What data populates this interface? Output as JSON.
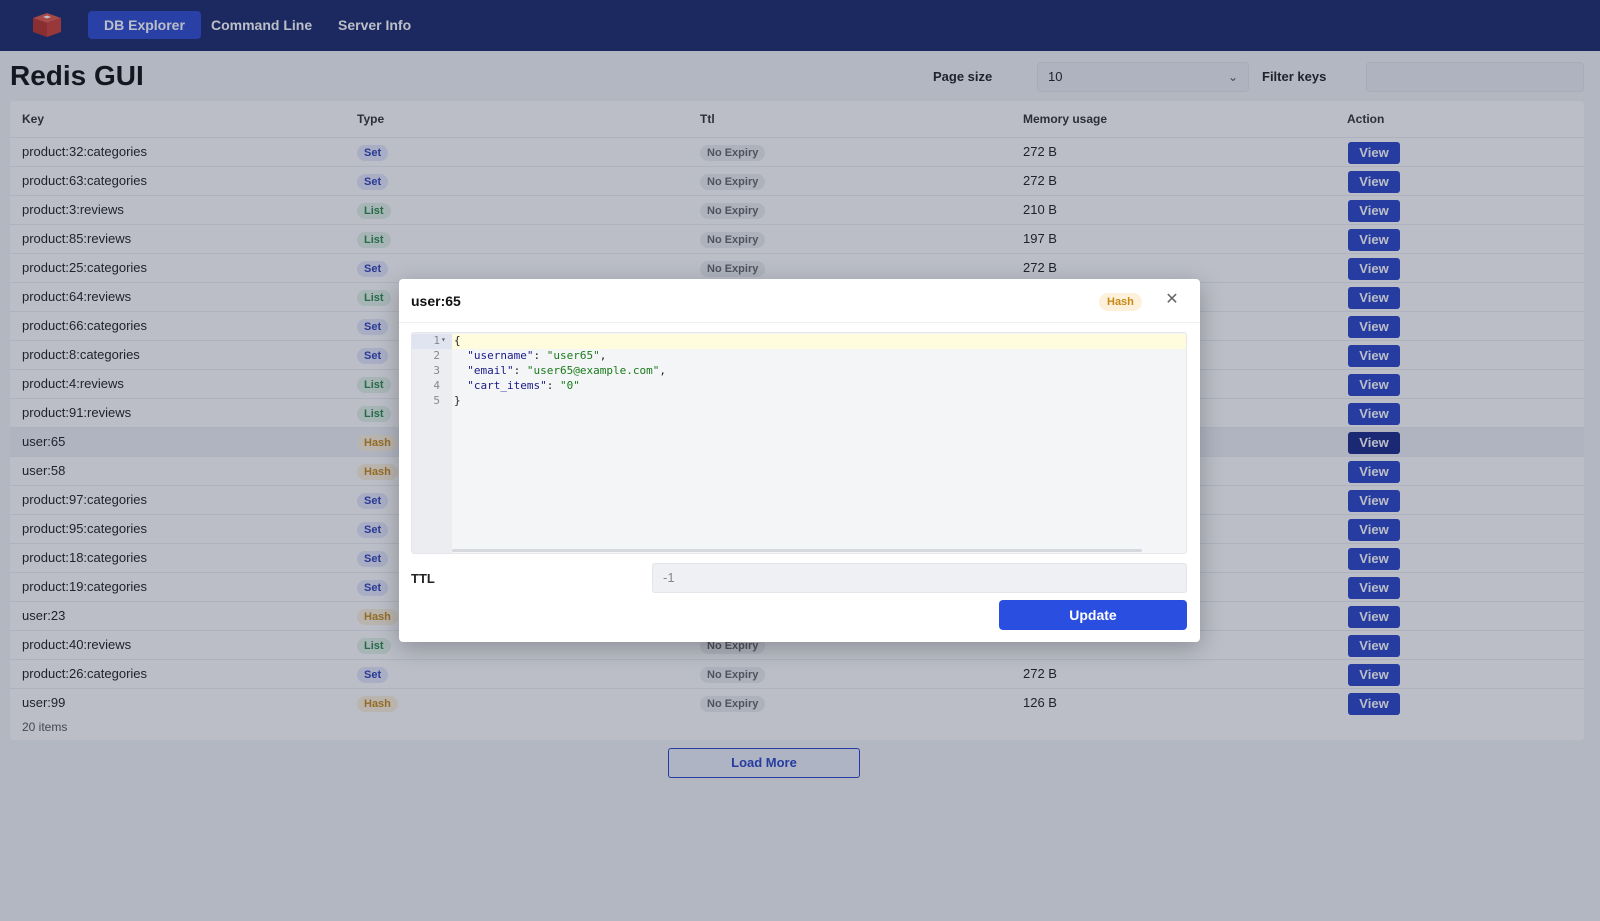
{
  "nav": {
    "logo_icon": "redis-logo-icon",
    "items": [
      {
        "label": "DB Explorer",
        "active": true
      },
      {
        "label": "Command Line",
        "active": false
      },
      {
        "label": "Server Info",
        "active": false
      }
    ]
  },
  "page": {
    "title": "Redis GUI",
    "page_size_label": "Page size",
    "page_size_value": "10",
    "filter_label": "Filter keys",
    "filter_placeholder": ""
  },
  "table": {
    "headers": [
      "Key",
      "Type",
      "Ttl",
      "Memory usage",
      "Action"
    ],
    "rows": [
      {
        "key": "product:32:categories",
        "type": "Set",
        "ttl": "No Expiry",
        "memory": "272 B",
        "action": "View"
      },
      {
        "key": "product:63:categories",
        "type": "Set",
        "ttl": "No Expiry",
        "memory": "272 B",
        "action": "View"
      },
      {
        "key": "product:3:reviews",
        "type": "List",
        "ttl": "No Expiry",
        "memory": "210 B",
        "action": "View"
      },
      {
        "key": "product:85:reviews",
        "type": "List",
        "ttl": "No Expiry",
        "memory": "197 B",
        "action": "View"
      },
      {
        "key": "product:25:categories",
        "type": "Set",
        "ttl": "No Expiry",
        "memory": "272 B",
        "action": "View"
      },
      {
        "key": "product:64:reviews",
        "type": "List",
        "ttl": "",
        "memory": "",
        "action": "View"
      },
      {
        "key": "product:66:categories",
        "type": "Set",
        "ttl": "",
        "memory": "",
        "action": "View"
      },
      {
        "key": "product:8:categories",
        "type": "Set",
        "ttl": "",
        "memory": "",
        "action": "View"
      },
      {
        "key": "product:4:reviews",
        "type": "List",
        "ttl": "",
        "memory": "",
        "action": "View"
      },
      {
        "key": "product:91:reviews",
        "type": "List",
        "ttl": "",
        "memory": "",
        "action": "View"
      },
      {
        "key": "user:65",
        "type": "Hash",
        "ttl": "",
        "memory": "",
        "action": "View"
      },
      {
        "key": "user:58",
        "type": "Hash",
        "ttl": "",
        "memory": "",
        "action": "View"
      },
      {
        "key": "product:97:categories",
        "type": "Set",
        "ttl": "",
        "memory": "",
        "action": "View"
      },
      {
        "key": "product:95:categories",
        "type": "Set",
        "ttl": "",
        "memory": "",
        "action": "View"
      },
      {
        "key": "product:18:categories",
        "type": "Set",
        "ttl": "",
        "memory": "",
        "action": "View"
      },
      {
        "key": "product:19:categories",
        "type": "Set",
        "ttl": "",
        "memory": "",
        "action": "View"
      },
      {
        "key": "user:23",
        "type": "Hash",
        "ttl": "",
        "memory": "",
        "action": "View"
      },
      {
        "key": "product:40:reviews",
        "type": "List",
        "ttl": "No Expiry",
        "memory": "",
        "action": "View"
      },
      {
        "key": "product:26:categories",
        "type": "Set",
        "ttl": "No Expiry",
        "memory": "272 B",
        "action": "View"
      },
      {
        "key": "user:99",
        "type": "Hash",
        "ttl": "No Expiry",
        "memory": "126 B",
        "action": "View"
      }
    ],
    "footer": "20 items",
    "load_more": "Load More"
  },
  "modal": {
    "title": "user:65",
    "type_tag": "Hash",
    "close_icon": "close-icon",
    "editor_lines": [
      {
        "num": "1",
        "text": "{"
      },
      {
        "num": "2",
        "key": "\"username\"",
        "value": "\"user65\"",
        "trail": ","
      },
      {
        "num": "3",
        "key": "\"email\"",
        "value": "\"user65@example.com\"",
        "trail": ","
      },
      {
        "num": "4",
        "key": "\"cart_items\"",
        "value": "\"0\"",
        "trail": ""
      },
      {
        "num": "5",
        "text": "}"
      }
    ],
    "ttl_label": "TTL",
    "ttl_value": "-1",
    "update_label": "Update"
  },
  "colors": {
    "nav_bg": "#1a2a6c",
    "accent": "#2a45c8",
    "set_tag": "#3042b8",
    "list_tag": "#2b8a4a",
    "hash_tag": "#c88a15"
  }
}
